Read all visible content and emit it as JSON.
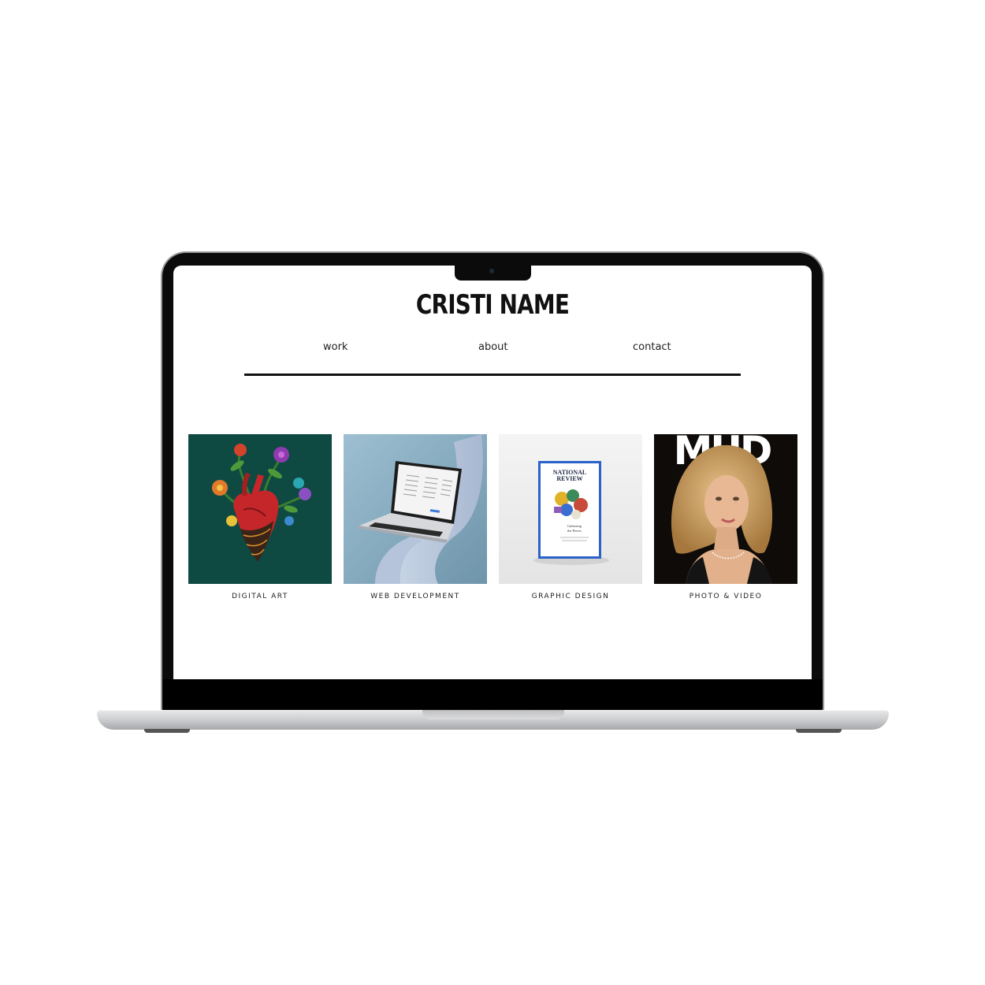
{
  "site": {
    "title": "CRISTI NAME",
    "nav": {
      "work": "work",
      "about": "about",
      "contact": "contact"
    }
  },
  "tiles": [
    {
      "caption": "DIGITAL ART",
      "image": "anatomical-heart-with-flowers-illustration"
    },
    {
      "caption": "WEB DEVELOPMENT",
      "image": "laptop-on-ribbon-mockup"
    },
    {
      "caption": "GRAPHIC DESIGN",
      "image": "magazine-mockup",
      "magazine_title": "NATIONAL REVIEW",
      "magazine_subtitle": "Gathering the Pieces"
    },
    {
      "caption": "PHOTO & VIDEO",
      "image": "magazine-cover-portrait",
      "cover_title": "MUD"
    }
  ],
  "colors": {
    "page_background": "#ffffff",
    "text": "#111111",
    "digital_art_bg": "#0e4a42",
    "web_dev_bg": "#8fb1c4",
    "graphic_design_bg": "#eeeeee",
    "magazine_blue": "#2a62c9"
  }
}
